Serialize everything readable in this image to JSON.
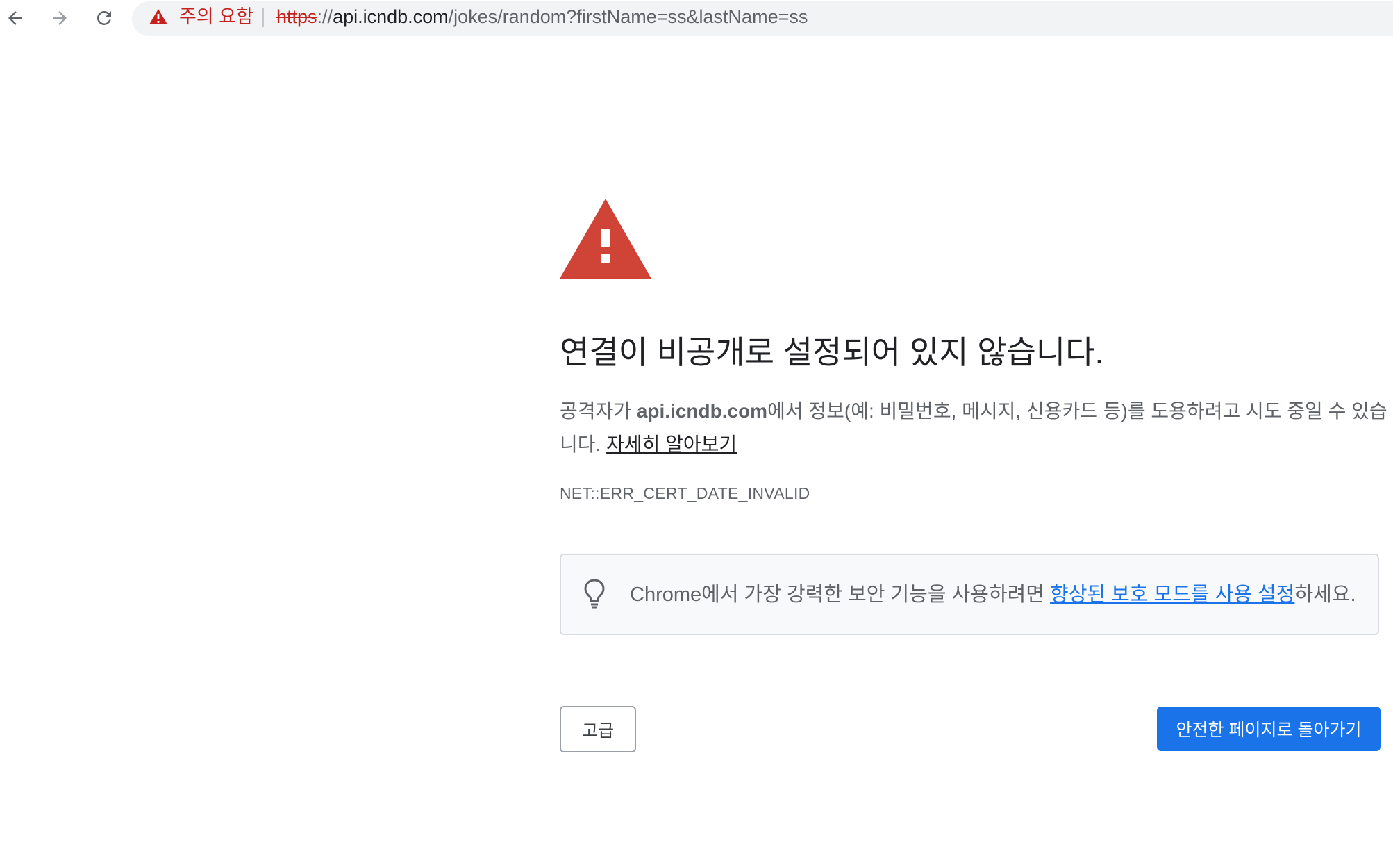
{
  "browser": {
    "security_chip": "주의 요함",
    "url": {
      "scheme": "https",
      "separator": "://",
      "host": "api.icndb.com",
      "path": "/jokes/random?firstName=ss&lastName=ss"
    },
    "icons": [
      "back-arrow-icon",
      "forward-arrow-icon",
      "reload-icon",
      "warning-icon"
    ]
  },
  "interstitial": {
    "heading": "연결이 비공개로 설정되어 있지 않습니다.",
    "body_prefix": "공격자가 ",
    "body_host": "api.icndb.com",
    "body_suffix": "에서 정보(예: 비밀번호, 메시지, 신용카드 등)를 도용하려고 시도 중일 수 있습니다. ",
    "learn_more": "자세히 알아보기",
    "error_code": "NET::ERR_CERT_DATE_INVALID",
    "tip": {
      "prefix": "Chrome에서 가장 강력한 보안 기능을 사용하려면 ",
      "link": "향상된 보호 모드를 사용 설정",
      "suffix": "하세요.",
      "icon": "lightbulb-icon"
    },
    "advanced_button": "고급",
    "back_to_safety_button": "안전한 페이지로 돌아가기"
  },
  "colors": {
    "warning_red": "#c5221f",
    "triangle_red": "#d04437",
    "link_blue": "#1a73e8",
    "primary_button": "#1a73e8",
    "text_primary": "#202124",
    "text_secondary": "#5f6368"
  }
}
